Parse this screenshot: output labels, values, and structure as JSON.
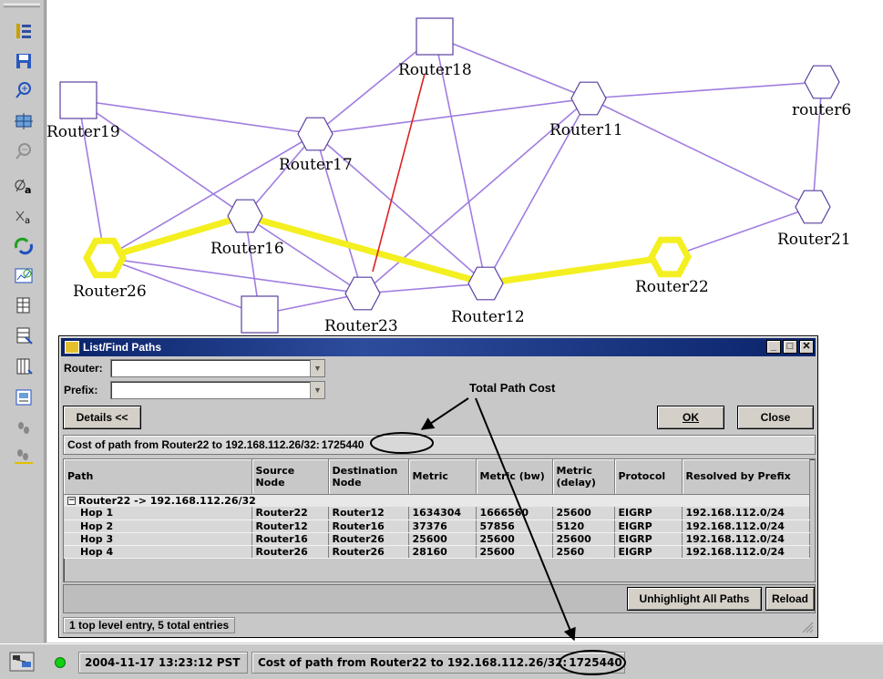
{
  "toolbar": {
    "icons": [
      "hierarchy-icon",
      "save-icon",
      "zoom-in-icon",
      "fit-view-icon",
      "zoom-out-icon",
      "label-a-icon",
      "label-small-a-icon",
      "refresh-icon",
      "chart-icon",
      "table-icon",
      "table-edit-icon",
      "table-columns-icon",
      "report-icon",
      "footprints-icon",
      "footprints-highlight-icon"
    ]
  },
  "network": {
    "nodes": [
      {
        "id": "Router18",
        "label": "Router18",
        "shape": "square",
        "highlight": false
      },
      {
        "id": "Router19",
        "label": "Router19",
        "shape": "square",
        "highlight": false
      },
      {
        "id": "Router11",
        "label": "Router11",
        "shape": "hexagon",
        "highlight": false
      },
      {
        "id": "router6",
        "label": "router6",
        "shape": "hexagon",
        "highlight": false
      },
      {
        "id": "Router17",
        "label": "Router17",
        "shape": "hexagon",
        "highlight": false
      },
      {
        "id": "Router16",
        "label": "Router16",
        "shape": "hexagon",
        "highlight": false
      },
      {
        "id": "Router21",
        "label": "Router21",
        "shape": "hexagon",
        "highlight": false
      },
      {
        "id": "Router26",
        "label": "Router26",
        "shape": "hexagon",
        "highlight": true
      },
      {
        "id": "Router22",
        "label": "Router22",
        "shape": "hexagon",
        "highlight": true
      },
      {
        "id": "Router12",
        "label": "Router12",
        "shape": "hexagon",
        "highlight": false
      },
      {
        "id": "Router23",
        "label": "Router23",
        "shape": "hexagon",
        "highlight": false
      },
      {
        "id": "RouterX",
        "label": "",
        "shape": "square",
        "highlight": false
      }
    ],
    "colors": {
      "link": "#a07de0",
      "path": "#f4ef20",
      "special": "#e02020",
      "node_stroke": "#5a3fa0"
    }
  },
  "dialog": {
    "title": "List/Find Paths",
    "router_label": "Router:",
    "router_value": "",
    "prefix_label": "Prefix:",
    "prefix_value": "",
    "details_label": "Details <<",
    "ok_label": "OK",
    "close_label": "Close",
    "cost_prefix": "Cost of path from Router22 to 192.168.112.26/32:",
    "cost_value": "1725440",
    "columns": [
      "Path",
      "Source Node",
      "Destination Node",
      "Metric",
      "Metric (bw)",
      "Metric (delay)",
      "Protocol",
      "Resolved by Prefix"
    ],
    "group_row": "Router22 -> 192.168.112.26/32",
    "hops": [
      {
        "path": "Hop 1",
        "source": "Router22",
        "dest": "Router12",
        "metric": "1634304",
        "bw": "1666560",
        "delay": "25600",
        "protocol": "EIGRP",
        "prefix": "192.168.112.0/24"
      },
      {
        "path": "Hop 2",
        "source": "Router12",
        "dest": "Router16",
        "metric": "37376",
        "bw": "57856",
        "delay": "5120",
        "protocol": "EIGRP",
        "prefix": "192.168.112.0/24"
      },
      {
        "path": "Hop 3",
        "source": "Router16",
        "dest": "Router26",
        "metric": "25600",
        "bw": "25600",
        "delay": "25600",
        "protocol": "EIGRP",
        "prefix": "192.168.112.0/24"
      },
      {
        "path": "Hop 4",
        "source": "Router26",
        "dest": "Router26",
        "metric": "28160",
        "bw": "25600",
        "delay": "2560",
        "protocol": "EIGRP",
        "prefix": "192.168.112.0/24"
      }
    ],
    "unhighlight_label": "Unhighlight All Paths",
    "reload_label": "Reload",
    "entries_status": "1 top level entry, 5 total entries"
  },
  "annotation": {
    "text": "Total Path Cost"
  },
  "statusbar": {
    "timestamp": "2004-11-17 13:23:12 PST",
    "message": "Cost of path from Router22 to 192.168.112.26/32:",
    "cost_value": "1725440"
  }
}
